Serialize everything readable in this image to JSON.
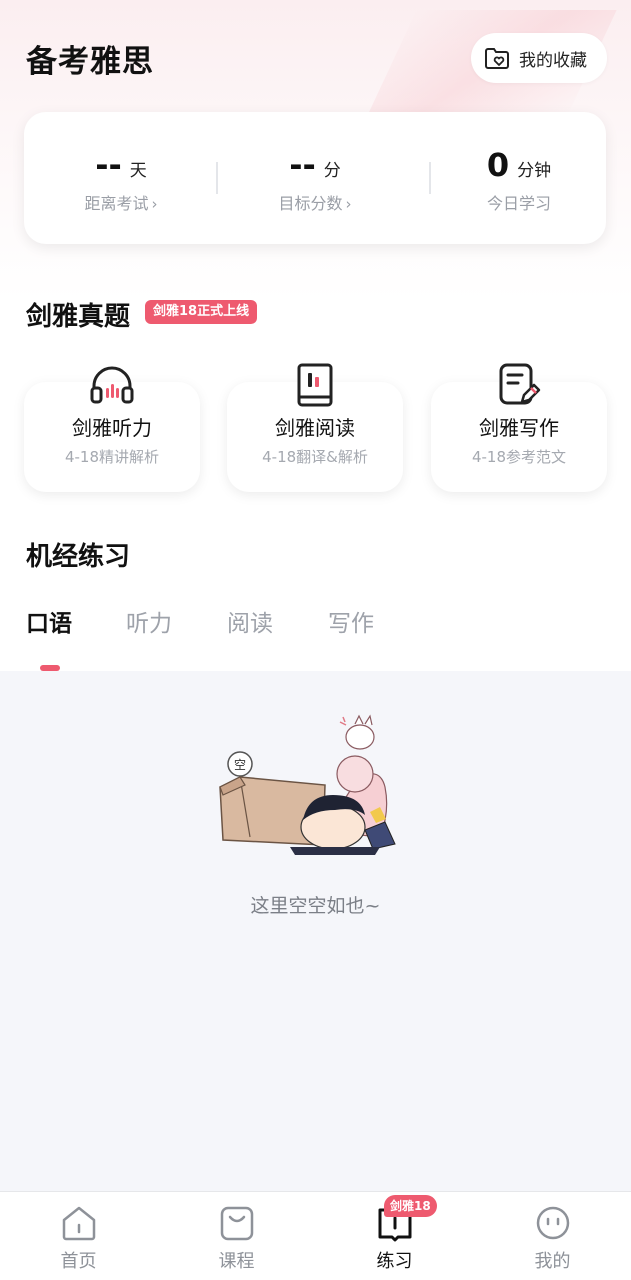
{
  "header": {
    "title": "备考雅思",
    "favorites_label": "我的收藏"
  },
  "stats": {
    "exam_days": {
      "value": "--",
      "unit": "天",
      "label": "距离考试"
    },
    "target_score": {
      "value": "--",
      "unit": "分",
      "label": "目标分数"
    },
    "today_study": {
      "value": "0",
      "unit": "分钟",
      "label": "今日学习"
    },
    "chevron": "›"
  },
  "real_tests": {
    "title": "剑雅真题",
    "badge": "剑雅18正式上线",
    "cards": [
      {
        "title": "剑雅听力",
        "sub": "4-18精讲解析",
        "icon": "headphones-icon"
      },
      {
        "title": "剑雅阅读",
        "sub": "4-18翻译&解析",
        "icon": "book-icon"
      },
      {
        "title": "剑雅写作",
        "sub": "4-18参考范文",
        "icon": "note-pen-icon"
      }
    ]
  },
  "machine_practice": {
    "title": "机经练习",
    "tabs": [
      "口语",
      "听力",
      "阅读",
      "写作"
    ],
    "active_tab": "口语",
    "empty_text": "这里空空如也~",
    "empty_bubble": "空"
  },
  "tabbar": {
    "items": [
      {
        "label": "首页",
        "icon": "home-icon"
      },
      {
        "label": "课程",
        "icon": "bag-icon"
      },
      {
        "label": "练习",
        "icon": "practice-icon"
      },
      {
        "label": "我的",
        "icon": "face-icon"
      }
    ],
    "active": "练习",
    "badge": "剑雅18"
  },
  "colors": {
    "accent": "#ee5a6f",
    "text_primary": "#111111",
    "text_muted": "#9a9ea6",
    "content_bg": "#f5f6fa"
  }
}
